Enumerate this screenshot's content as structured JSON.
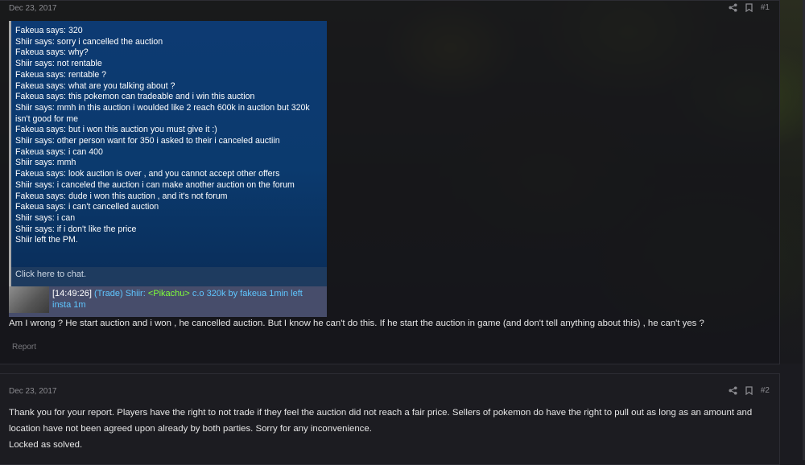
{
  "posts": [
    {
      "date": "Dec 23, 2017",
      "number": "#1",
      "screenshot": {
        "chat_lines": [
          "Fakeua says: 320",
          "Shiir says: sorry i cancelled the auction",
          "Fakeua says: why?",
          "Shiir says: not rentable",
          "Fakeua says: rentable ?",
          "Fakeua says: what are you talking about ?",
          "Fakeua says: this pokemon can tradeable and i win this auction",
          "Shiir says: mmh in this auction i woulded like 2 reach 600k in auction but 320k isn't good for me",
          "Fakeua says: but i won this auction you must give it :)",
          "Shiir says: other person want for 350 i asked to their i canceled auctiin",
          "Fakeua says: i can 400",
          "Shiir says: mmh",
          "Fakeua says: look auction is over , and you cannot accept other offers",
          "Shiir says: i canceled the auction i can make another auction on the forum",
          "Fakeua says: dude i won this auction , and it's not forum",
          "Fakeua says: i can't cancelled auction",
          "Shiir says: i can",
          "Shiir says: if i don't like the price",
          "Shiir left the PM."
        ],
        "chat_prompt": "Click here to chat.",
        "trade": {
          "time": "[14:49:26]",
          "prefix": "(Trade) Shiir: ",
          "pokemon": "<Pikachu>",
          "rest": " c.o 320k by fakeua 1min left insta 1m"
        }
      },
      "text": "Am I wrong ? He start auction and i won , he cancelled auction. But I know he can't do this. If he start the auction in game (and don't tell anything about this) , he can't yes ?",
      "report_label": "Report"
    },
    {
      "date": "Dec 23, 2017",
      "number": "#2",
      "text_lines": [
        "Thank you for your report. Players have the right to not trade if they feel the auction did not reach a fair price. Sellers of pokemon do have the right to pull out as long as an amount and location have not been agreed upon already by both parties. Sorry for any inconvenience.",
        "Locked as solved."
      ]
    }
  ],
  "icons": {
    "share": "share-icon",
    "bookmark": "bookmark-icon"
  },
  "colors": {
    "chat_bg": "#0b3a6e",
    "trade_text": "#5fc6ff",
    "pokemon_tag": "#7fff3a",
    "page_bg": "#1b1b20"
  }
}
